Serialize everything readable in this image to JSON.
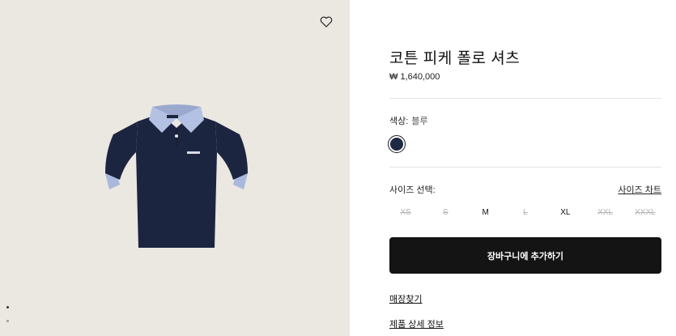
{
  "gallery": {
    "wishlist_icon": "heart-outline-icon",
    "background": "#ebe7e1",
    "slides_visible": 2,
    "active_slide": 1
  },
  "product": {
    "title": "코튼 피케 폴로 셔츠",
    "price": "₩ 1,640,000"
  },
  "color": {
    "label": "색상:",
    "value": "블루",
    "swatch_color": "#1e2a44"
  },
  "size": {
    "label": "사이즈 선택:",
    "chart_link": "사이즈 차트",
    "options": [
      {
        "label": "XS",
        "available": false
      },
      {
        "label": "S",
        "available": false
      },
      {
        "label": "M",
        "available": true
      },
      {
        "label": "L",
        "available": false
      },
      {
        "label": "XL",
        "available": true
      },
      {
        "label": "XXL",
        "available": false
      },
      {
        "label": "XXXL",
        "available": false
      }
    ]
  },
  "cta": {
    "add_to_cart": "장바구니에 추가하기"
  },
  "links": {
    "find_store": "매장찾기",
    "product_details": "제품 상세 정보"
  }
}
